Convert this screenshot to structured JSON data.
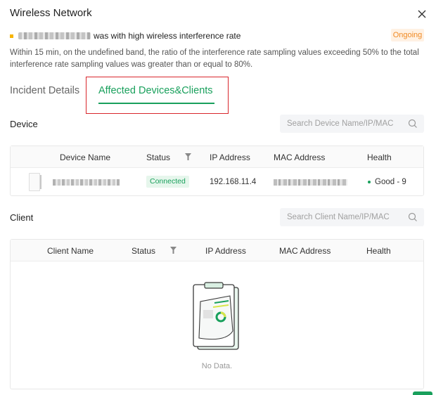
{
  "dialog": {
    "title": "Wireless Network"
  },
  "incident": {
    "text": "was with high wireless interference rate",
    "status": "Ongoing",
    "description": "Within 15 min, on the undefined band, the ratio of the interference rate sampling values exceeding 50% to the total interference rate sampling values was greater than or equal to 80%."
  },
  "tabs": [
    {
      "label": "Incident Details"
    },
    {
      "label": "Affected Devices&Clients"
    }
  ],
  "device_section": {
    "title": "Device",
    "search_placeholder": "Search Device Name/IP/MAC",
    "columns": [
      "Device Name",
      "Status",
      "IP Address",
      "MAC Address",
      "Health"
    ],
    "rows": [
      {
        "status": "Connected",
        "ip": "192.168.11.4",
        "health": "Good - 9"
      }
    ]
  },
  "client_section": {
    "title": "Client",
    "search_placeholder": "Search Client Name/IP/MAC",
    "columns": [
      "Client Name",
      "Status",
      "IP Address",
      "MAC Address",
      "Health"
    ],
    "empty_text": "No Data."
  },
  "colors": {
    "accent": "#19a05c",
    "warning": "#f08a24",
    "highlight_box": "#d9262c"
  }
}
